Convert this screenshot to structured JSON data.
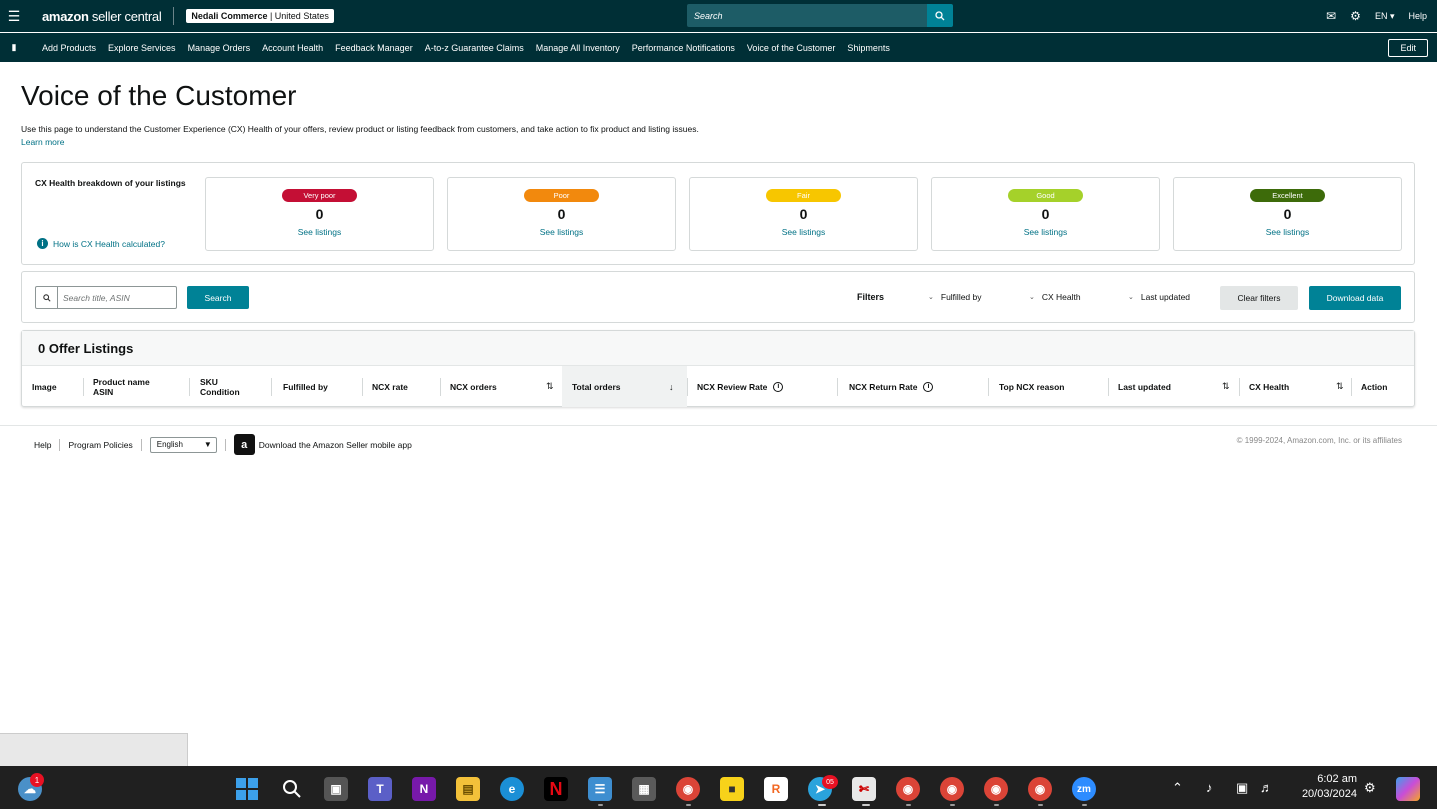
{
  "topbar": {
    "logo_bold": "amazon",
    "logo_light": " seller central",
    "account_name": "Nedali Commerce",
    "account_region": "United States",
    "search_placeholder": "Search",
    "language": "EN",
    "help": "Help"
  },
  "nav": {
    "items": [
      "Add Products",
      "Explore Services",
      "Manage Orders",
      "Account Health",
      "Feedback Manager",
      "A-to-z Guarantee Claims",
      "Manage All Inventory",
      "Performance Notifications",
      "Voice of the Customer",
      "Shipments"
    ],
    "edit": "Edit"
  },
  "page": {
    "title": "Voice of the Customer",
    "intro": "Use this page to understand the Customer Experience (CX) Health of your offers, review product or listing feedback from customers, and take action to fix product and listing issues.",
    "learn_more": "Learn more"
  },
  "cx": {
    "title": "CX Health breakdown of your listings",
    "how_link": "How is CX Health calculated?",
    "cards": [
      {
        "label": "Very poor",
        "count": "0",
        "link": "See listings",
        "color": "#c40f35"
      },
      {
        "label": "Poor",
        "count": "0",
        "link": "See listings",
        "color": "#f2890d"
      },
      {
        "label": "Fair",
        "count": "0",
        "link": "See listings",
        "color": "#f7c600"
      },
      {
        "label": "Good",
        "count": "0",
        "link": "See listings",
        "color": "#a5d12a"
      },
      {
        "label": "Excellent",
        "count": "0",
        "link": "See listings",
        "color": "#3d6b0a"
      }
    ]
  },
  "filterbar": {
    "search_placeholder": "Search title, ASIN",
    "search_button": "Search",
    "filters_label": "Filters",
    "fulfilled_by": "Fulfilled by",
    "cx_health": "CX Health",
    "last_updated": "Last updated",
    "clear_filters": "Clear filters",
    "download": "Download data"
  },
  "table": {
    "heading": "0 Offer Listings",
    "columns": {
      "image": "Image",
      "product_name": "Product name",
      "asin": "ASIN",
      "sku": "SKU",
      "condition": "Condition",
      "fulfilled_by": "Fulfilled by",
      "ncx_rate": "NCX rate",
      "ncx_orders": "NCX orders",
      "total_orders": "Total orders",
      "ncx_review_rate": "NCX Review Rate",
      "ncx_return_rate": "NCX Return Rate",
      "top_ncx_reason": "Top NCX reason",
      "last_updated": "Last updated",
      "cx_health": "CX Health",
      "action": "Action"
    }
  },
  "footer": {
    "help": "Help",
    "program_policies": "Program Policies",
    "language": "English",
    "app_text": "Download the Amazon Seller mobile app",
    "copyright": "© 1999-2024, Amazon.com, Inc. or its affiliates"
  },
  "taskbar": {
    "weather_badge": "1",
    "telegram_badge": "05",
    "time": "6:02 am",
    "date": "20/03/2024"
  }
}
